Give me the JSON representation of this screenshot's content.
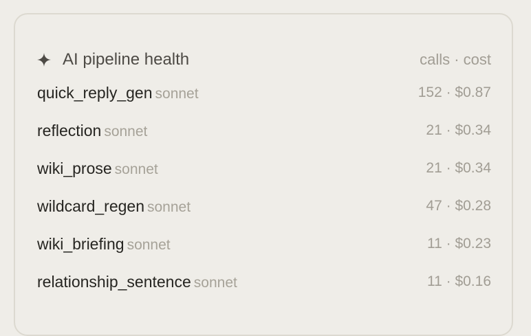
{
  "panel": {
    "title": "AI pipeline health",
    "header_right": "calls · cost",
    "title_icon": "sparkle-icon"
  },
  "pipelines": [
    {
      "name": "quick_reply_gen",
      "model": "sonnet",
      "stats": "152 · $0.87"
    },
    {
      "name": "reflection",
      "model": "sonnet",
      "stats": "21 · $0.34"
    },
    {
      "name": "wiki_prose",
      "model": "sonnet",
      "stats": "21 · $0.34"
    },
    {
      "name": "wildcard_regen",
      "model": "sonnet",
      "stats": "47 · $0.28"
    },
    {
      "name": "wiki_briefing",
      "model": "sonnet",
      "stats": "11 · $0.23"
    },
    {
      "name": "relationship_sentence",
      "model": "sonnet",
      "stats": "11 · $0.16"
    }
  ]
}
